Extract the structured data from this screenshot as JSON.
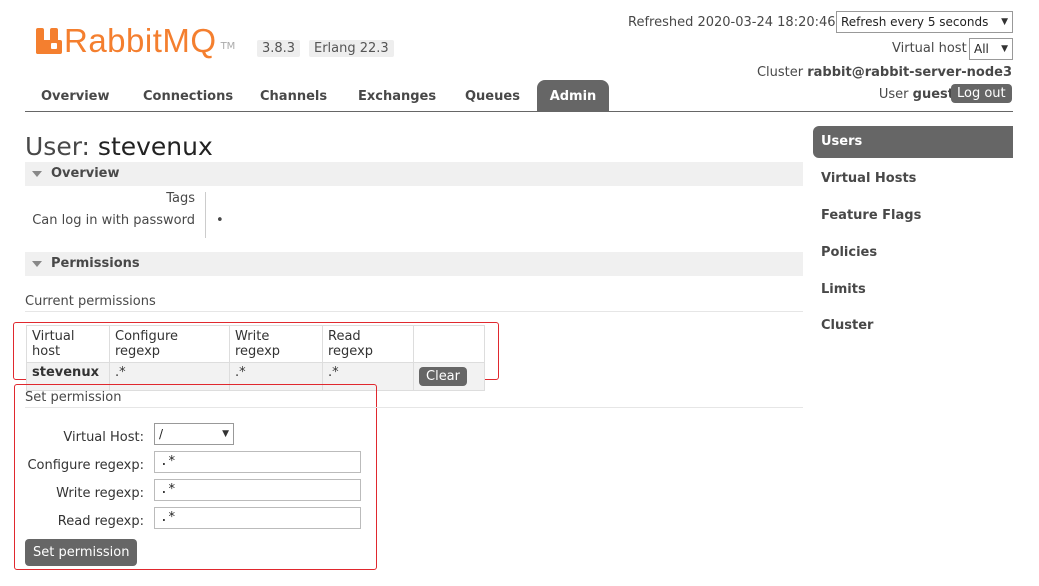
{
  "header": {
    "logo_text": "RabbitMQ",
    "logo_tm": "TM",
    "version": "3.8.3",
    "erlang": "Erlang 22.3",
    "refreshed": "Refreshed 2020-03-24 18:20:46",
    "refresh_select": "Refresh every 5 seconds",
    "vhost_label": "Virtual host",
    "vhost_select": "All",
    "cluster_label": "Cluster",
    "cluster_name": "rabbit@rabbit-server-node3",
    "user_label": "User",
    "user_name": "guest",
    "logout_label": "Log out"
  },
  "nav": {
    "tabs": [
      {
        "label": "Overview"
      },
      {
        "label": "Connections"
      },
      {
        "label": "Channels"
      },
      {
        "label": "Exchanges"
      },
      {
        "label": "Queues"
      },
      {
        "label": "Admin"
      }
    ],
    "active": "Admin"
  },
  "page": {
    "title_prefix": "User:",
    "title_name": "stevenux"
  },
  "overview": {
    "section_label": "Overview",
    "tags_label": "Tags",
    "tags_value": "",
    "can_login_label": "Can log in with password",
    "can_login_value": "•"
  },
  "permissions": {
    "section_label": "Permissions",
    "current_label": "Current permissions",
    "columns": [
      "Virtual host",
      "Configure regexp",
      "Write regexp",
      "Read regexp"
    ],
    "rows": [
      {
        "vhost": "stevenux",
        "configure": ".*",
        "write": ".*",
        "read": ".*",
        "action": "Clear"
      }
    ]
  },
  "set_permission": {
    "section_label": "Set permission",
    "vhost_label": "Virtual Host:",
    "vhost_value": "/",
    "configure_label": "Configure regexp:",
    "configure_value": ".*",
    "write_label": "Write regexp:",
    "write_value": ".*",
    "read_label": "Read regexp:",
    "read_value": ".*",
    "submit_label": "Set permission"
  },
  "sidebar": {
    "items": [
      {
        "label": "Users"
      },
      {
        "label": "Virtual Hosts"
      },
      {
        "label": "Feature Flags"
      },
      {
        "label": "Policies"
      },
      {
        "label": "Limits"
      },
      {
        "label": "Cluster"
      }
    ],
    "active": "Users"
  },
  "colors": {
    "brand": "#f47f2f",
    "active_tab": "#666666",
    "highlight_box": "#e0282e"
  }
}
